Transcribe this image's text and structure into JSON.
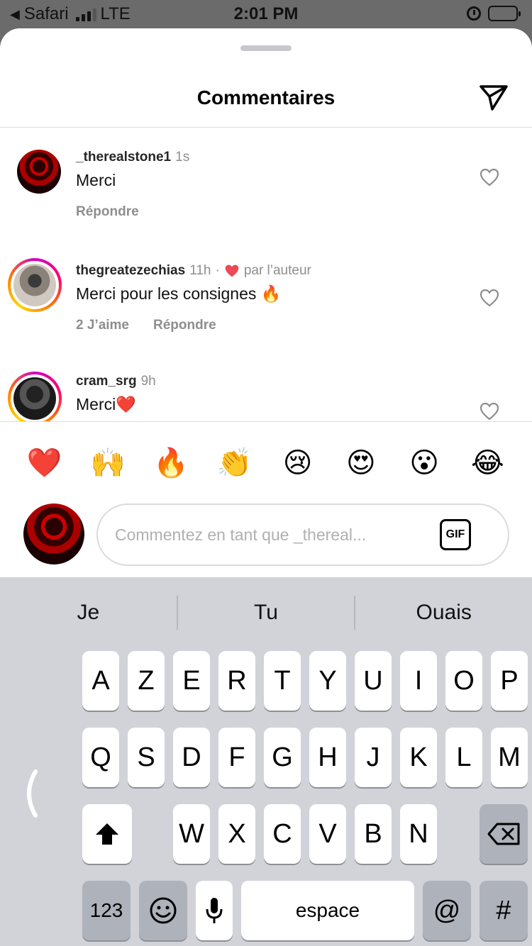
{
  "status_bar": {
    "back_app": "Safari",
    "network": "LTE",
    "time": "2:01 PM",
    "battery_level": 0.55
  },
  "header": {
    "title": "Commentaires",
    "send_icon": "paper-plane-icon"
  },
  "comments": [
    {
      "username": "_therealstone1",
      "time": "1s",
      "text": "Merci",
      "likes": "",
      "reply_label": "Répondre",
      "liked_by_author": false
    },
    {
      "username": "thegreatezechias",
      "time": "11h",
      "separator": "·",
      "author_like_label": "par l’auteur",
      "text": "Merci pour les consignes 🔥",
      "likes": "2 J’aime",
      "reply_label": "Répondre",
      "liked_by_author": true
    },
    {
      "username": "cram_srg",
      "time": "9h",
      "text": "Merci❤️",
      "likes": "",
      "reply_label": "",
      "liked_by_author": false
    }
  ],
  "emoji_bar": [
    "❤️",
    "🙌",
    "🔥",
    "👏",
    "😢",
    "😍",
    "😮",
    "😂"
  ],
  "compose": {
    "placeholder": "Commentez en tant que _thereal...",
    "gif_label": "GIF"
  },
  "keyboard": {
    "suggestions": [
      "Je",
      "Tu",
      "Ouais"
    ],
    "row1": [
      "A",
      "Z",
      "E",
      "R",
      "T",
      "Y",
      "U",
      "I",
      "O",
      "P"
    ],
    "row2": [
      "Q",
      "S",
      "D",
      "F",
      "G",
      "H",
      "J",
      "K",
      "L",
      "M"
    ],
    "row3": [
      "W",
      "X",
      "C",
      "V",
      "B",
      "N"
    ],
    "numbers_label": "123",
    "space_label": "espace",
    "at_label": "@",
    "hash_label": "#"
  },
  "colors": {
    "heart_red": "#ed4956",
    "ring_gradient_start": "#d300c5",
    "ring_gradient_end": "#ffd600",
    "muted_text": "#8e8e8e"
  }
}
